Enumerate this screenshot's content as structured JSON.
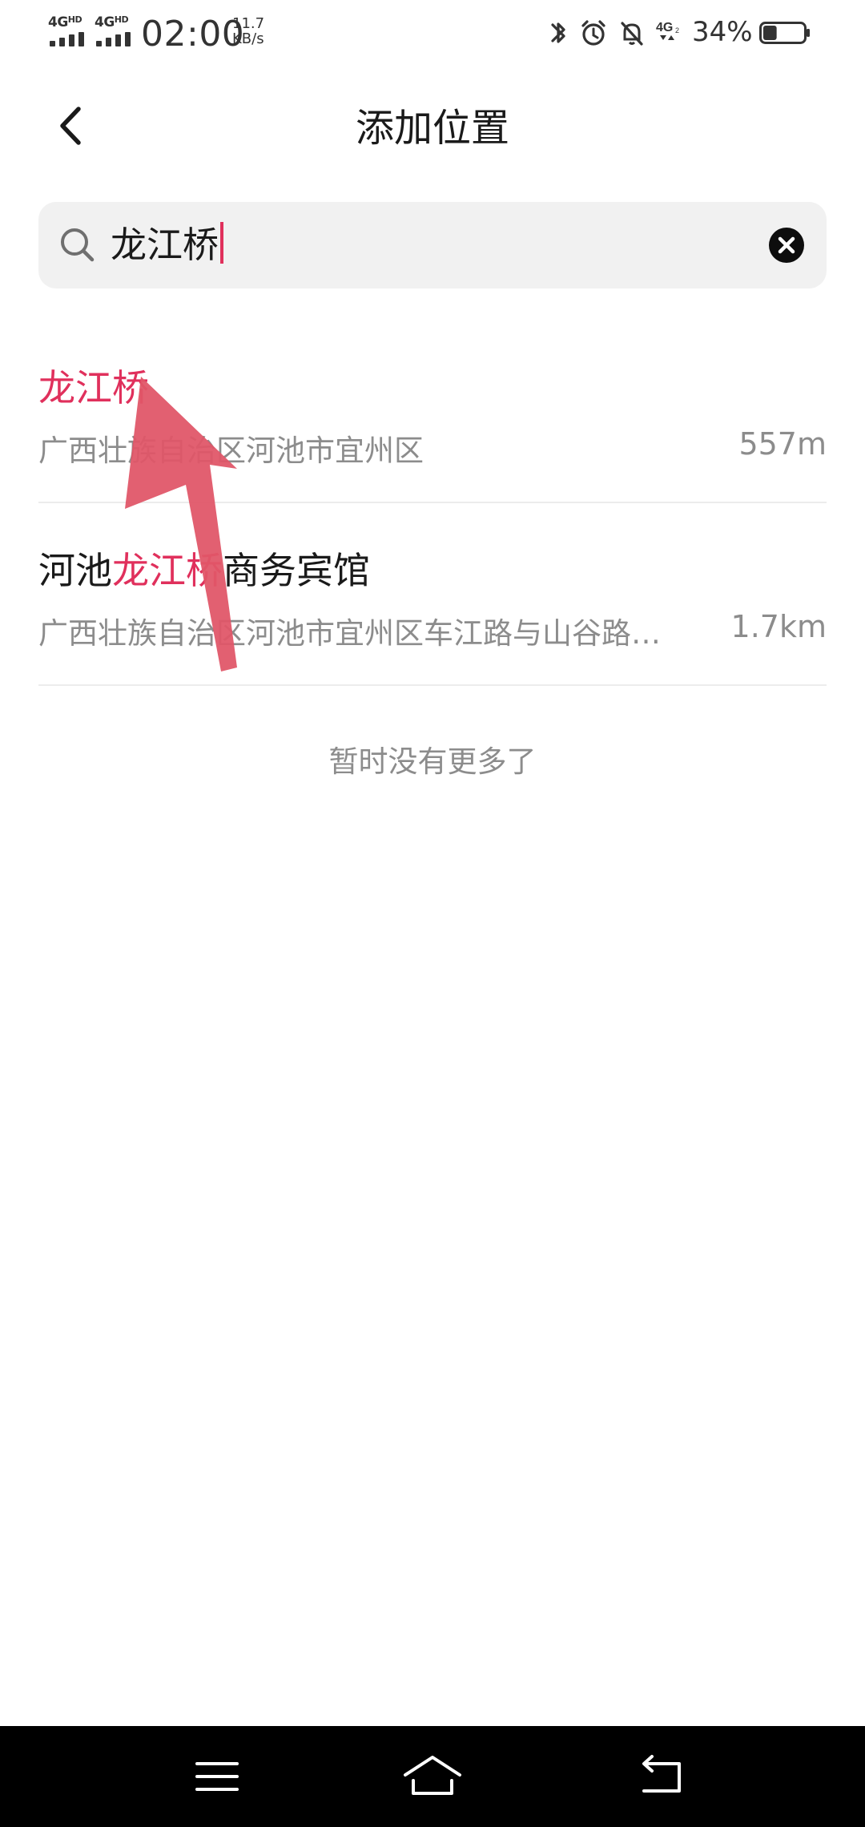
{
  "status_bar": {
    "sim1": "4G",
    "sim1_sup": "HD",
    "sim2": "4G",
    "sim2_sup": "HD",
    "time": "02:00",
    "net_speed_value": "11.7",
    "net_speed_unit": "KB/s",
    "icons": [
      "bluetooth-icon",
      "alarm-icon",
      "mute-icon",
      "4g-data-icon"
    ],
    "battery_percent": "34%",
    "battery_level": 0.34
  },
  "header": {
    "title": "添加位置"
  },
  "search": {
    "value": "龙江桥"
  },
  "results": [
    {
      "name_prefix": "",
      "name_highlight": "龙江桥",
      "name_suffix": "",
      "address": "广西壮族自治区河池市宜州区",
      "distance": "557m"
    },
    {
      "name_prefix": "河池",
      "name_highlight": "龙江桥",
      "name_suffix": "商务宾馆",
      "address": "广西壮族自治区河池市宜州区车江路与山谷路…",
      "distance": "1.7km"
    }
  ],
  "footer_note": "暂时没有更多了",
  "colors": {
    "accent": "#e0305c",
    "annotation_arrow": "#e05668",
    "secondary_text": "#8c8c8c",
    "nav_bar": "#000000"
  }
}
